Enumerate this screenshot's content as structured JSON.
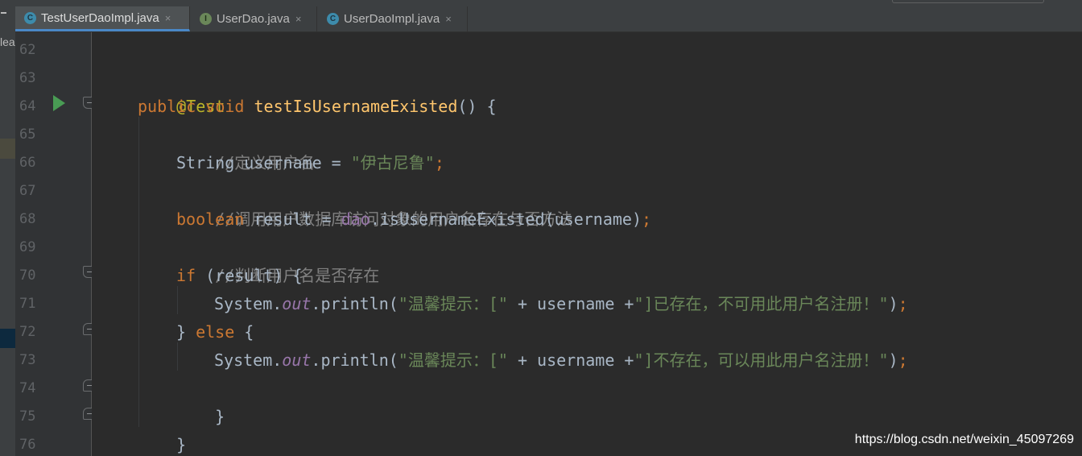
{
  "left_panel": {
    "peek_text": "lea"
  },
  "tabs": [
    {
      "label": "TestUserDaoImpl.java",
      "icon": "class-test-icon",
      "active": true
    },
    {
      "label": "UserDao.java",
      "icon": "interface-icon",
      "active": false
    },
    {
      "label": "UserDaoImpl.java",
      "icon": "class-icon",
      "active": false
    }
  ],
  "tab_close_glyph": "×",
  "icon_letters": {
    "class": "C",
    "interface": "I"
  },
  "line_numbers": [
    "62",
    "63",
    "64",
    "65",
    "66",
    "67",
    "68",
    "69",
    "70",
    "71",
    "72",
    "73",
    "74",
    "75",
    "76"
  ],
  "code": {
    "l63": {
      "annotation": "@Test"
    },
    "l64": {
      "kw1": "public",
      "kw2": "void",
      "method": "testIsUsernameExisted",
      "rest": "() {"
    },
    "l65": {
      "comment": "//定义用户名"
    },
    "l66": {
      "type": "String",
      "mid": " username = ",
      "string": "\"伊古尼鲁\"",
      "semi": ";"
    },
    "l67": {
      "comment": "//调用用户数据库访问对象的用户名存在与否方法"
    },
    "l68": {
      "kw": "boolean",
      "mid": " result = ",
      "field": "dao",
      "call": ".isUsernameExisted(username)",
      "semi": ";"
    },
    "l69": {
      "comment": "//判断用户名是否存在"
    },
    "l70": {
      "kw": "if",
      "rest": " (result) {"
    },
    "l71": {
      "obj": "System.",
      "field": "out",
      "call": ".println(",
      "str1": "\"温馨提示：[\"",
      "mid": " + username +",
      "str2": "\"]已存在，不可用此用户名注册！\"",
      "end": ")",
      "semi": ";"
    },
    "l72": {
      "brace": "} ",
      "kw": "else",
      "rest": " {"
    },
    "l73": {
      "obj": "System.",
      "field": "out",
      "call": ".println(",
      "str1": "\"温馨提示：[\"",
      "mid": " + username +",
      "str2": "\"]不存在，可以用此用户名注册！\"",
      "end": ")",
      "semi": ";"
    },
    "l74": {
      "brace": "}"
    },
    "l75": {
      "brace": "}"
    }
  },
  "watermark": "https://blog.csdn.net/weixin_45097269"
}
